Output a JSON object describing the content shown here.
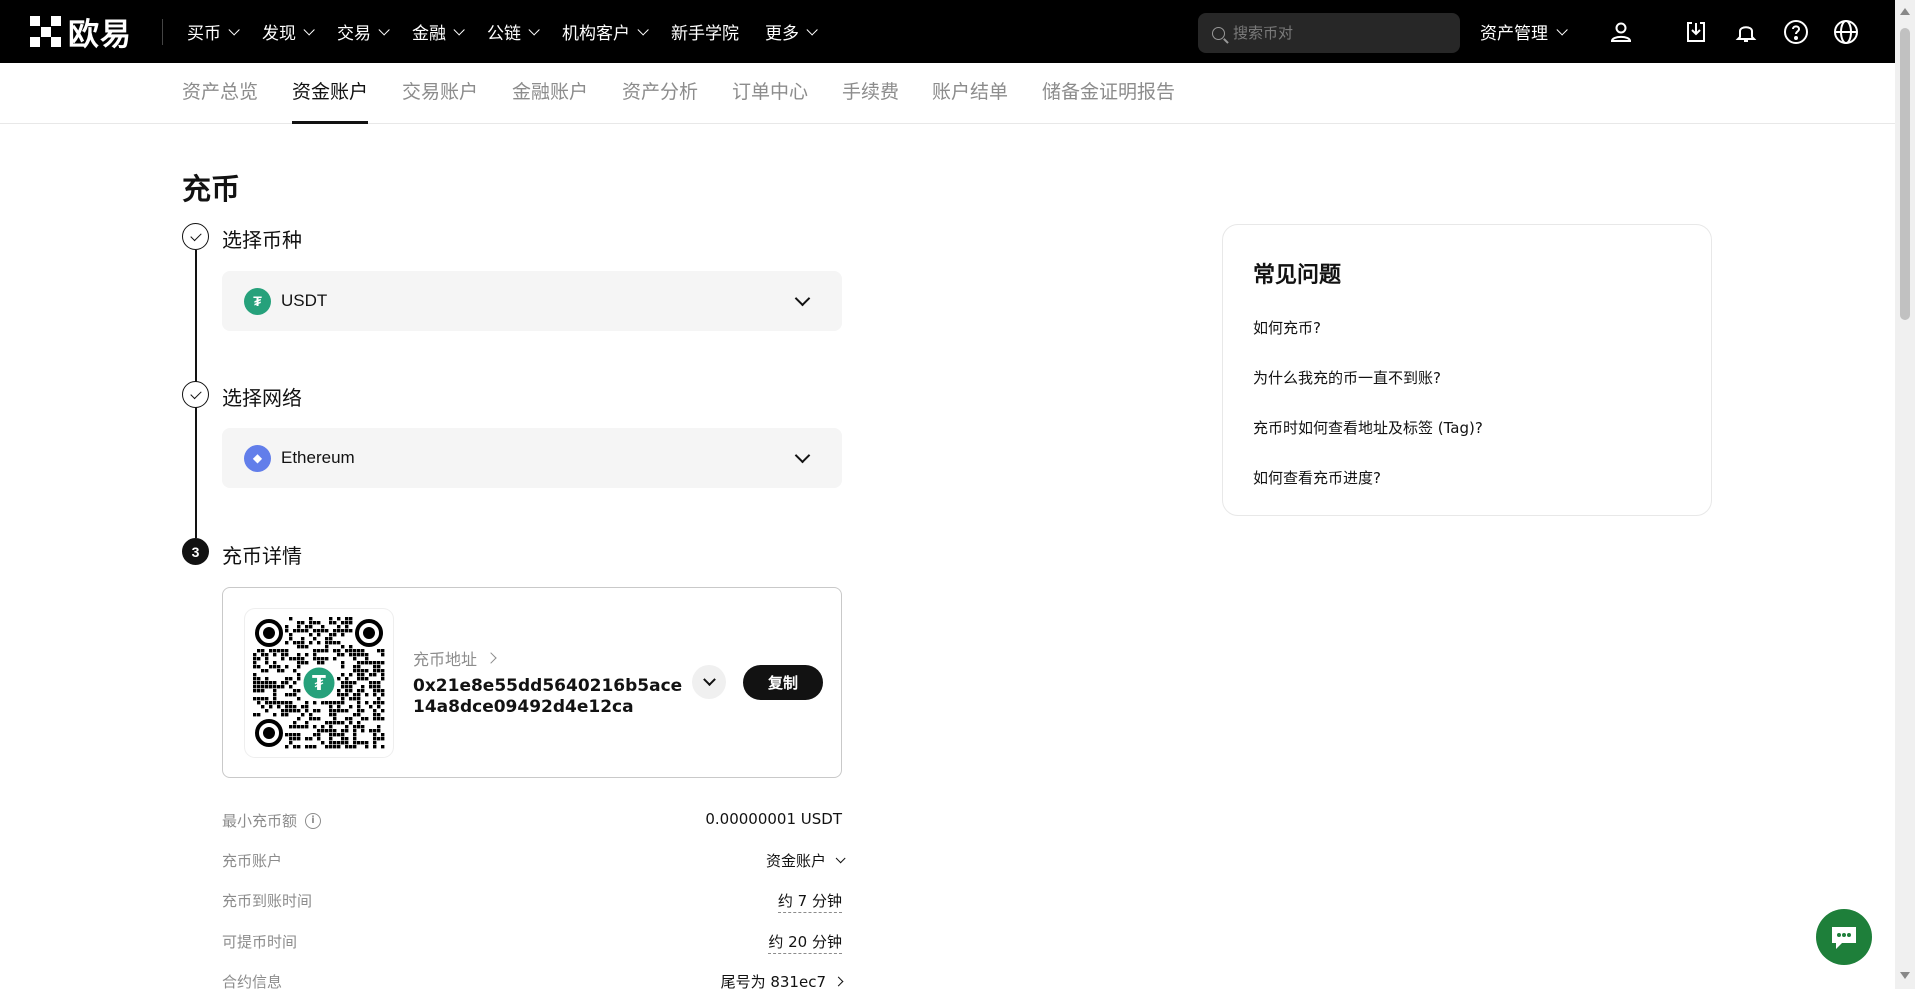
{
  "brand": {
    "name": "欧易"
  },
  "nav": {
    "items": [
      {
        "label": "买币",
        "dropdown": true
      },
      {
        "label": "发现",
        "dropdown": true
      },
      {
        "label": "交易",
        "dropdown": true
      },
      {
        "label": "金融",
        "dropdown": true
      },
      {
        "label": "公链",
        "dropdown": true
      },
      {
        "label": "机构客户",
        "dropdown": true
      },
      {
        "label": "新手学院",
        "dropdown": false
      },
      {
        "label": "更多",
        "dropdown": true
      }
    ],
    "search_placeholder": "搜索币对",
    "asset_management": "资产管理"
  },
  "subnav": {
    "items": [
      "资产总览",
      "资金账户",
      "交易账户",
      "金融账户",
      "资产分析",
      "订单中心",
      "手续费",
      "账户结单",
      "储备金证明报告"
    ],
    "active_index": 1
  },
  "page": {
    "title": "充币",
    "steps": [
      {
        "label": "选择币种",
        "state": "done"
      },
      {
        "label": "选择网络",
        "state": "done"
      },
      {
        "label": "充币详情",
        "state": "current",
        "number": "3"
      }
    ],
    "coin_select": {
      "value": "USDT",
      "icon": "tether-icon",
      "color": "#26a17b",
      "glyph": "₮"
    },
    "network_select": {
      "value": "Ethereum",
      "icon": "ethereum-icon",
      "color": "#627eea",
      "glyph": "◆"
    },
    "deposit": {
      "address_label": "充币地址",
      "address": "0x21e8e55dd5640216b5ace14a8dce09492d4e12ca",
      "copy_label": "复制"
    },
    "info_rows": [
      {
        "key": "最小充币额",
        "value": "0.00000001 USDT",
        "has_info": true,
        "info_glyph": "i",
        "style": "plain"
      },
      {
        "key": "充币账户",
        "value": "资金账户",
        "style": "dropdown"
      },
      {
        "key": "充币到账时间",
        "value": "约 7 分钟",
        "style": "dashed"
      },
      {
        "key": "可提币时间",
        "value": "约 20 分钟",
        "style": "dashed"
      },
      {
        "key": "合约信息",
        "value": "尾号为 831ec7",
        "style": "link"
      }
    ]
  },
  "faq": {
    "title": "常见问题",
    "items": [
      "如何充币?",
      "为什么我充的币一直不到账?",
      "充币时如何查看地址及标签 (Tag)?",
      "如何查看充币进度?"
    ]
  },
  "colors": {
    "topbar_bg": "#000000",
    "accent": "#121212",
    "tether": "#26a17b",
    "ethereum": "#627eea"
  }
}
